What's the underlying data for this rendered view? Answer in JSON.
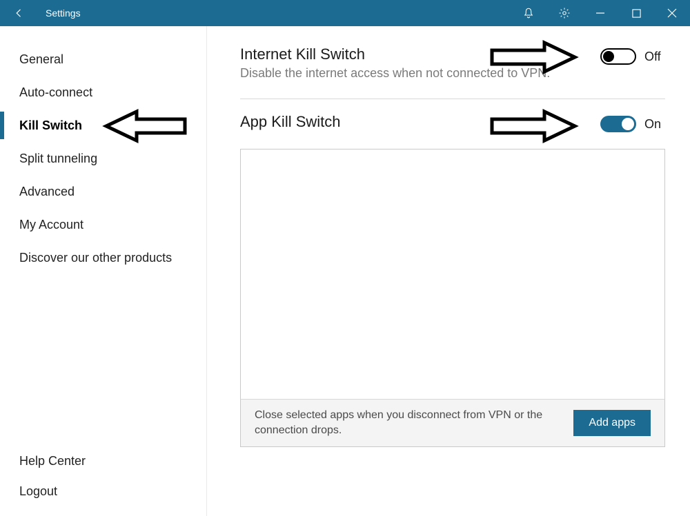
{
  "titlebar": {
    "title": "Settings"
  },
  "sidebar": {
    "items": [
      {
        "label": "General"
      },
      {
        "label": "Auto-connect"
      },
      {
        "label": "Kill Switch",
        "active": true
      },
      {
        "label": "Split tunneling"
      },
      {
        "label": "Advanced"
      },
      {
        "label": "My Account"
      },
      {
        "label": "Discover our other products"
      }
    ],
    "bottom": [
      {
        "label": "Help Center"
      },
      {
        "label": "Logout"
      }
    ]
  },
  "main": {
    "internet_kill": {
      "title": "Internet Kill Switch",
      "subtitle": "Disable the internet access when not connected to VPN.",
      "state_label": "Off"
    },
    "app_kill": {
      "title": "App Kill Switch",
      "state_label": "On"
    },
    "bottom_text": "Close selected apps when you disconnect from VPN or the connection drops.",
    "add_button": "Add apps"
  }
}
